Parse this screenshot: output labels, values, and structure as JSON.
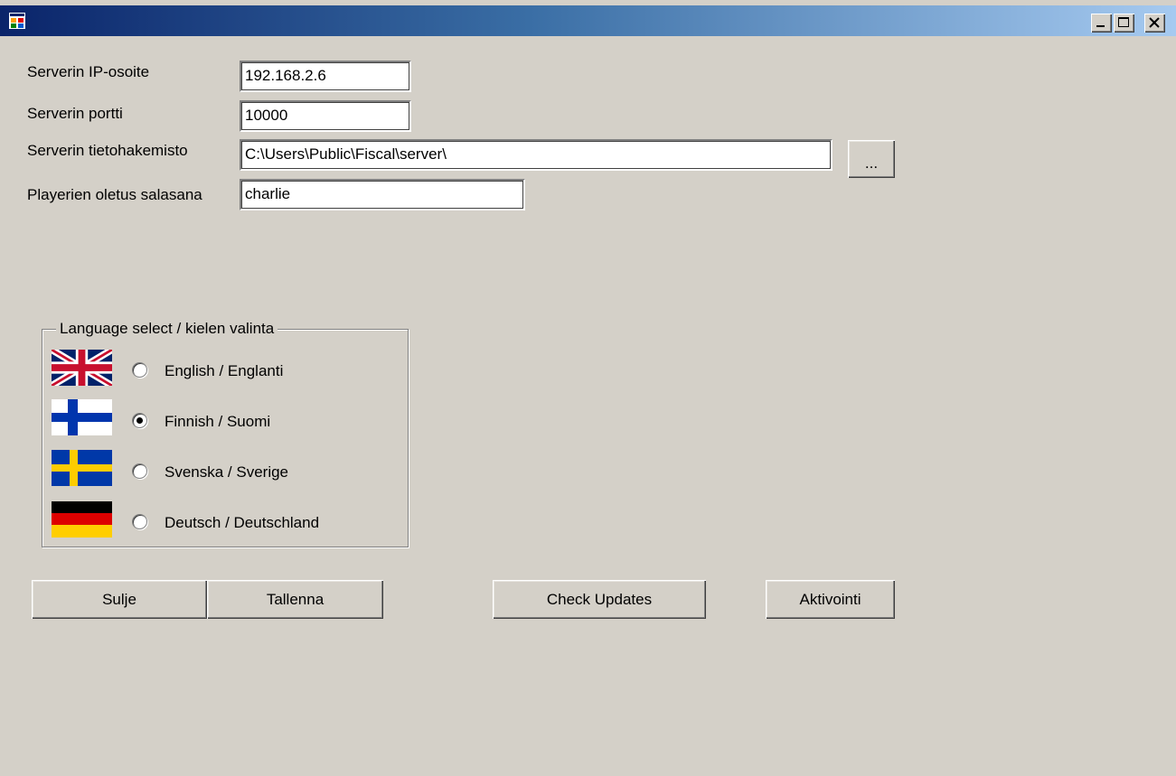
{
  "window": {
    "title": "",
    "icon": "app-window-icon",
    "controls": [
      "minimize-icon",
      "maximize-icon",
      "close-icon"
    ]
  },
  "form": {
    "ip_label": "Serverin IP-osoite",
    "ip_value": "192.168.2.6",
    "port_label": "Serverin portti",
    "port_value": "10000",
    "dir_label": "Serverin tietohakemisto",
    "dir_value": "C:\\Users\\Public\\Fiscal\\server\\",
    "browse_label": "...",
    "password_label": "Playerien oletus salasana",
    "password_value": "charlie"
  },
  "language": {
    "group_label": "Language select / kielen valinta",
    "options": [
      {
        "label": "English / Englanti",
        "flag": "uk-flag-icon",
        "selected": false
      },
      {
        "label": "Finnish / Suomi",
        "flag": "finland-flag-icon",
        "selected": true
      },
      {
        "label": "Svenska / Sverige",
        "flag": "sweden-flag-icon",
        "selected": false
      },
      {
        "label": "Deutsch / Deutschland",
        "flag": "germany-flag-icon",
        "selected": false
      }
    ]
  },
  "buttons": {
    "close_label": "Sulje",
    "save_label": "Tallenna",
    "updates_label": "Check Updates",
    "activate_label": "Aktivointi"
  },
  "colors": {
    "window_bg": "#d4d0c8",
    "title_start": "#0a246a",
    "title_end": "#a6caf0"
  }
}
